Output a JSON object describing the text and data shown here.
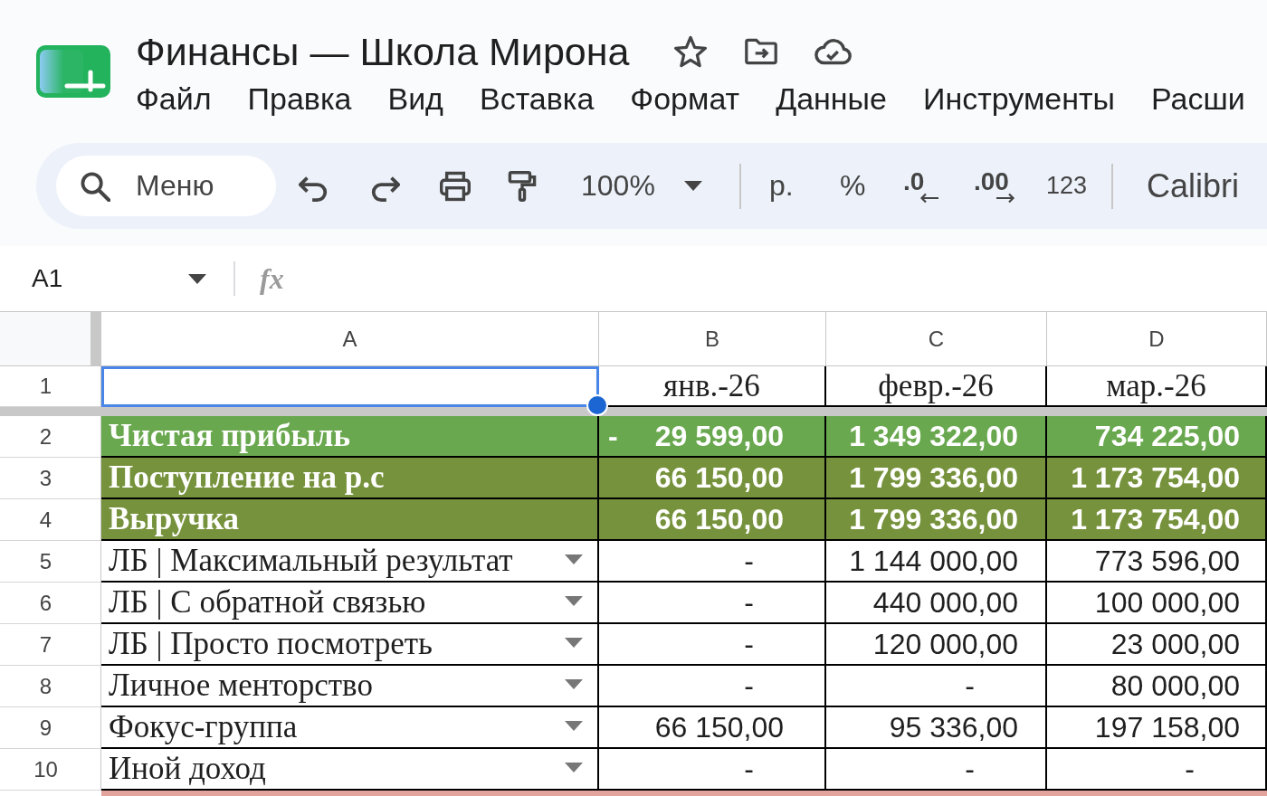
{
  "document": {
    "title": "Финансы — Школа Мирона"
  },
  "menu": [
    "Файл",
    "Правка",
    "Вид",
    "Вставка",
    "Формат",
    "Данные",
    "Инструменты",
    "Расши"
  ],
  "toolbar": {
    "search": {
      "placeholder": "Меню"
    },
    "zoom": "100%",
    "currency": "р.",
    "percent": "%",
    "decrease_decimals": ".0",
    "increase_decimals": ".00",
    "more_formats": "123",
    "font": "Calibri"
  },
  "formula_bar": {
    "cell_ref": "A1",
    "label": "fx"
  },
  "sheet": {
    "columns": [
      "A",
      "B",
      "C",
      "D"
    ],
    "rows": [
      {
        "number": "1",
        "kind": "header",
        "dropdown": false,
        "cells": [
          {
            "kind": "empty",
            "selected": true
          },
          {
            "kind": "month",
            "text": "янв.-26",
            "selected": false
          },
          {
            "kind": "month",
            "text": "февр.-26",
            "selected": false
          },
          {
            "kind": "month",
            "text": "мар.-26",
            "selected": false
          }
        ]
      },
      {
        "number": "2",
        "kind": "summary",
        "color": "#6aa84f",
        "dropdown": false,
        "cells": [
          {
            "kind": "label",
            "text": "Чистая прибыль",
            "selected": false
          },
          {
            "kind": "amount",
            "sign": "-",
            "text": "29 599,00",
            "selected": false
          },
          {
            "kind": "amount",
            "text": "1 349 322,00",
            "selected": false
          },
          {
            "kind": "amount",
            "text": "734 225,00",
            "selected": false
          }
        ]
      },
      {
        "number": "3",
        "kind": "summary",
        "color": "#76923c",
        "dropdown": false,
        "cells": [
          {
            "kind": "label",
            "text": "Поступление на р.с",
            "selected": false
          },
          {
            "kind": "amount",
            "text": "66 150,00",
            "selected": false
          },
          {
            "kind": "amount",
            "text": "1 799 336,00",
            "selected": false
          },
          {
            "kind": "amount",
            "text": "1 173 754,00",
            "selected": false
          }
        ]
      },
      {
        "number": "4",
        "kind": "summary",
        "color": "#76923c",
        "dropdown": false,
        "cells": [
          {
            "kind": "label",
            "text": "Выручка",
            "selected": false
          },
          {
            "kind": "amount",
            "text": "66 150,00",
            "selected": false
          },
          {
            "kind": "amount",
            "text": "1 799 336,00",
            "selected": false
          },
          {
            "kind": "amount",
            "text": "1 173 754,00",
            "selected": false
          }
        ]
      },
      {
        "number": "5",
        "kind": "item",
        "dropdown": true,
        "cells": [
          {
            "kind": "label",
            "text": "ЛБ | Максимальный результат",
            "selected": false
          },
          {
            "kind": "dash",
            "text": "-",
            "selected": false
          },
          {
            "kind": "amount",
            "text": "1 144 000,00",
            "selected": false
          },
          {
            "kind": "amount",
            "text": "773 596,00",
            "selected": false
          }
        ]
      },
      {
        "number": "6",
        "kind": "item",
        "dropdown": true,
        "cells": [
          {
            "kind": "label",
            "text": "ЛБ | С обратной связью",
            "selected": false
          },
          {
            "kind": "dash",
            "text": "-",
            "selected": false
          },
          {
            "kind": "amount",
            "text": "440 000,00",
            "selected": false
          },
          {
            "kind": "amount",
            "text": "100 000,00",
            "selected": false
          }
        ]
      },
      {
        "number": "7",
        "kind": "item",
        "dropdown": true,
        "cells": [
          {
            "kind": "label",
            "text": "ЛБ | Просто посмотреть",
            "selected": false
          },
          {
            "kind": "dash",
            "text": "-",
            "selected": false
          },
          {
            "kind": "amount",
            "text": "120 000,00",
            "selected": false
          },
          {
            "kind": "amount",
            "text": "23 000,00",
            "selected": false
          }
        ]
      },
      {
        "number": "8",
        "kind": "item",
        "dropdown": true,
        "cells": [
          {
            "kind": "label",
            "text": "Личное менторство",
            "selected": false
          },
          {
            "kind": "dash",
            "text": "-",
            "selected": false
          },
          {
            "kind": "dash",
            "text": "-",
            "selected": false
          },
          {
            "kind": "amount",
            "text": "80 000,00",
            "selected": false
          }
        ]
      },
      {
        "number": "9",
        "kind": "item",
        "dropdown": true,
        "cells": [
          {
            "kind": "label",
            "text": "Фокус-группа",
            "selected": false
          },
          {
            "kind": "amount",
            "text": "66 150,00",
            "selected": false
          },
          {
            "kind": "amount",
            "text": "95 336,00",
            "selected": false
          },
          {
            "kind": "amount",
            "text": "197 158,00",
            "selected": false
          }
        ]
      },
      {
        "number": "10",
        "kind": "item",
        "dropdown": true,
        "cells": [
          {
            "kind": "label",
            "text": "Иной доход",
            "selected": false
          },
          {
            "kind": "dash",
            "text": "-",
            "selected": false
          },
          {
            "kind": "dash",
            "text": "-",
            "selected": false
          },
          {
            "kind": "dash",
            "text": "-",
            "selected": false
          }
        ]
      }
    ]
  }
}
